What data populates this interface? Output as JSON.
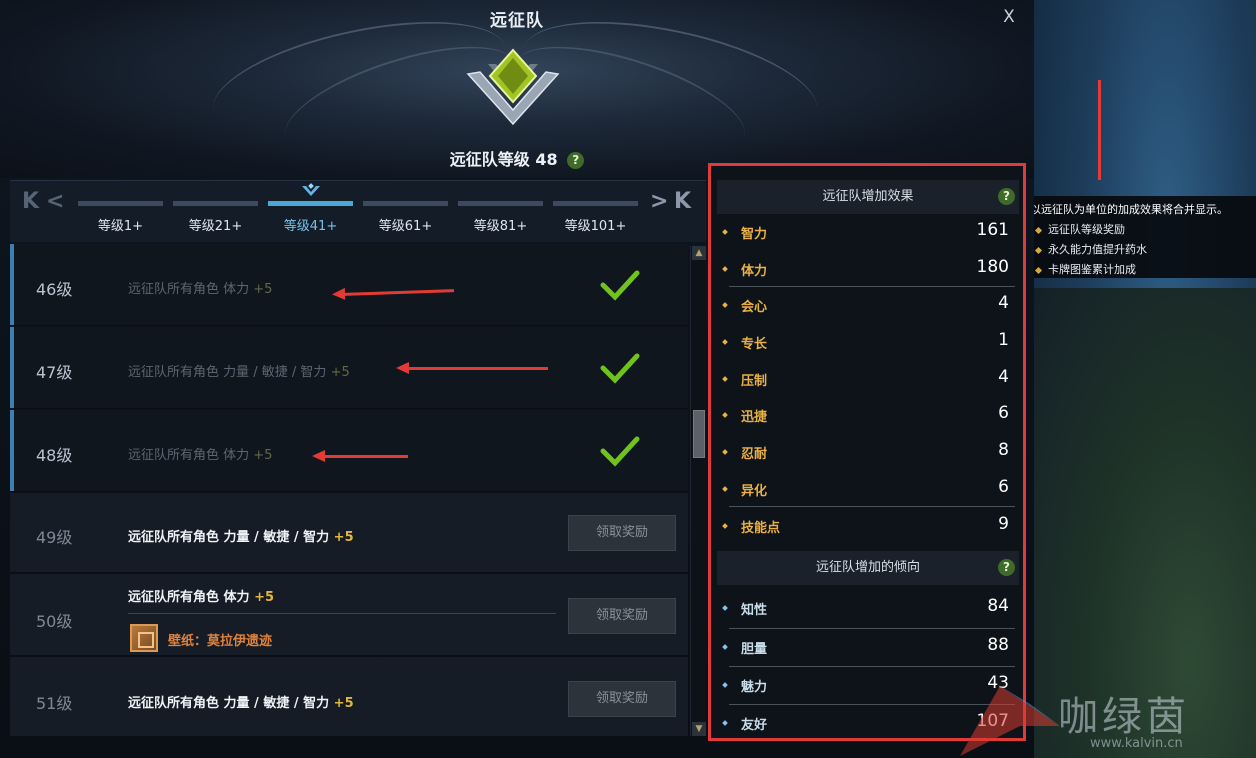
{
  "window": {
    "title": "远征队",
    "close_label": "X",
    "level_label": "远征队等级 48",
    "help": "?"
  },
  "tier_tabs": {
    "nav_first": "K",
    "nav_prev": "<",
    "nav_next": ">",
    "nav_last": "K",
    "tabs": [
      {
        "label": "等级1+"
      },
      {
        "label": "等级21+"
      },
      {
        "label": "等级41+"
      },
      {
        "label": "等级61+"
      },
      {
        "label": "等级81+"
      },
      {
        "label": "等级101+"
      }
    ],
    "active_index": 2
  },
  "rewards": [
    {
      "level": "46级",
      "desc": "远征队所有角色 体力",
      "plus": "+5",
      "status": "claimed"
    },
    {
      "level": "47级",
      "desc": "远征队所有角色 力量 / 敏捷 / 智力",
      "plus": "+5",
      "status": "claimed"
    },
    {
      "level": "48级",
      "desc": "远征队所有角色 体力",
      "plus": "+5",
      "status": "claimed"
    },
    {
      "level": "49级",
      "desc": "远征队所有角色 力量 / 敏捷 / 智力",
      "plus": "+5",
      "status": "pending",
      "button": "领取奖励"
    },
    {
      "level": "50级",
      "desc": "远征队所有角色 体力",
      "plus": "+5",
      "status": "pending",
      "button": "领取奖励",
      "extra": "壁纸：莫拉伊遗迹"
    },
    {
      "level": "51级",
      "desc": "远征队所有角色 力量 / 敏捷 / 智力",
      "plus": "+5",
      "status": "pending",
      "button": "领取奖励"
    }
  ],
  "effects_panel": {
    "header": "远征队增加效果",
    "help": "?",
    "stats": [
      {
        "name": "智力",
        "value": "161"
      },
      {
        "name": "体力",
        "value": "180"
      },
      {
        "name": "会心",
        "value": "4"
      },
      {
        "name": "专长",
        "value": "1"
      },
      {
        "name": "压制",
        "value": "4"
      },
      {
        "name": "迅捷",
        "value": "6"
      },
      {
        "name": "忍耐",
        "value": "8"
      },
      {
        "name": "异化",
        "value": "6"
      },
      {
        "name": "技能点",
        "value": "9"
      }
    ]
  },
  "tendency_panel": {
    "header": "远征队增加的倾向",
    "help": "?",
    "stats": [
      {
        "name": "知性",
        "value": "84"
      },
      {
        "name": "胆量",
        "value": "88"
      },
      {
        "name": "魅力",
        "value": "43"
      },
      {
        "name": "友好",
        "value": "107"
      }
    ]
  },
  "tooltip": {
    "title": "以远征队为单位的加成效果将合并显示。",
    "items": [
      "远征队等级奖励",
      "永久能力值提升药水",
      "卡牌图鉴累计加成"
    ]
  },
  "watermark": {
    "text": "咖绿茵",
    "url": "www.kalvin.cn"
  },
  "colors": {
    "accent_blue": "#4aa8d9",
    "highlight_red": "#e03a3a",
    "stat_orange": "#e9b144",
    "check_green": "#6fc31c"
  }
}
